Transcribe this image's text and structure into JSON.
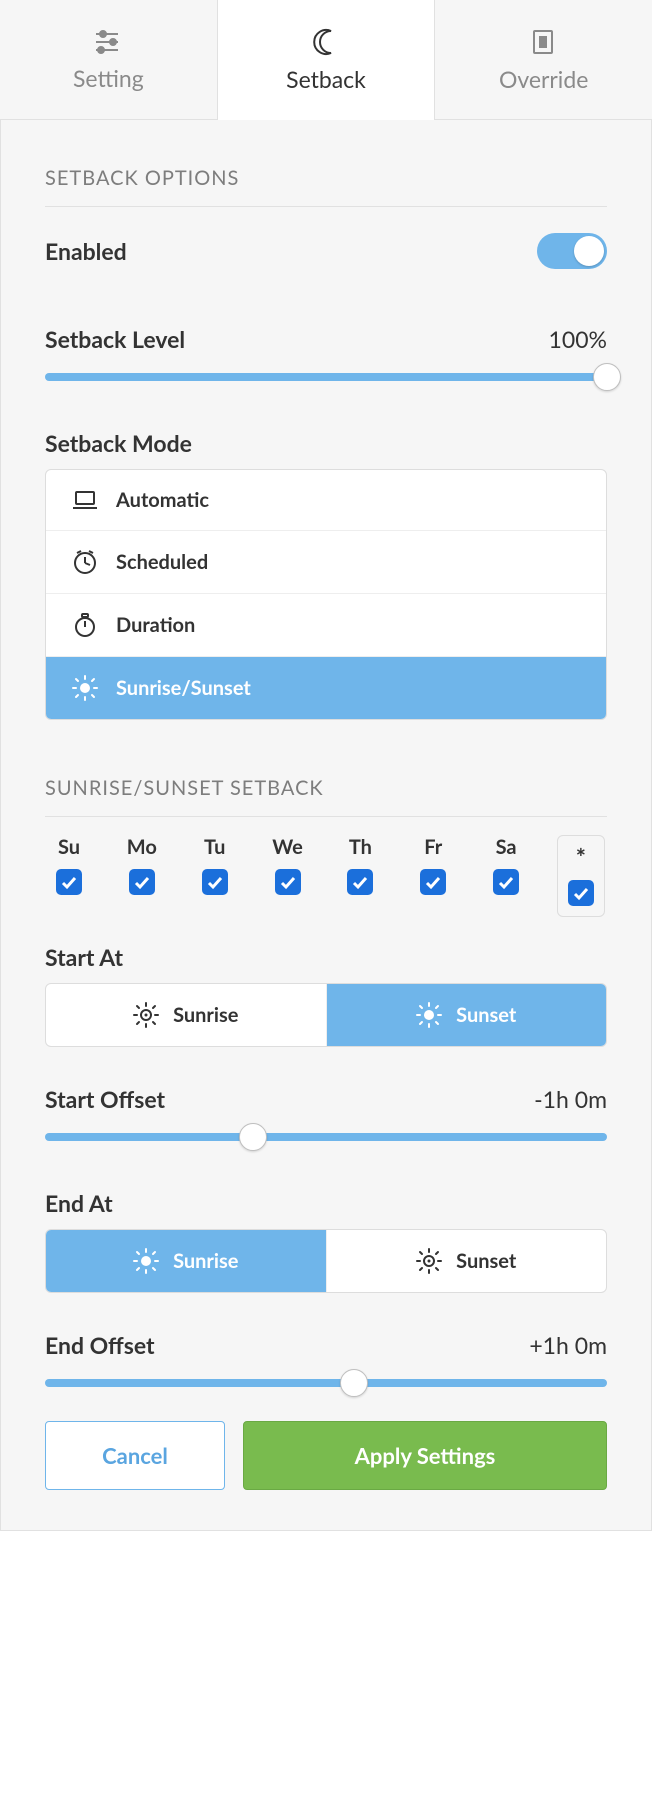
{
  "tabs": {
    "setting": "Setting",
    "setback": "Setback",
    "override": "Override",
    "active": "setback"
  },
  "section1_title": "SETBACK OPTIONS",
  "enabled": {
    "label": "Enabled",
    "value": true
  },
  "level": {
    "label": "Setback Level",
    "value_text": "100%",
    "percent": 100
  },
  "mode": {
    "label": "Setback Mode",
    "items": {
      "automatic": "Automatic",
      "scheduled": "Scheduled",
      "duration": "Duration",
      "sunrise": "Sunrise/Sunset"
    },
    "selected": "sunrise"
  },
  "section2_title": "SUNRISE/SUNSET SETBACK",
  "days": {
    "su": "Su",
    "mo": "Mo",
    "tu": "Tu",
    "we": "We",
    "th": "Th",
    "fr": "Fr",
    "sa": "Sa",
    "all_symbol": "*",
    "checked": {
      "su": true,
      "mo": true,
      "tu": true,
      "we": true,
      "th": true,
      "fr": true,
      "sa": true,
      "all": true
    }
  },
  "start": {
    "label": "Start At",
    "options": {
      "sunrise": "Sunrise",
      "sunset": "Sunset"
    },
    "selected": "sunset"
  },
  "start_offset": {
    "label": "Start Offset",
    "value_text": "-1h 0m",
    "thumb_percent": 37
  },
  "end": {
    "label": "End At",
    "options": {
      "sunrise": "Sunrise",
      "sunset": "Sunset"
    },
    "selected": "sunrise"
  },
  "end_offset": {
    "label": "End Offset",
    "value_text": "+1h 0m",
    "thumb_percent": 55
  },
  "footer": {
    "cancel": "Cancel",
    "apply": "Apply Settings"
  }
}
